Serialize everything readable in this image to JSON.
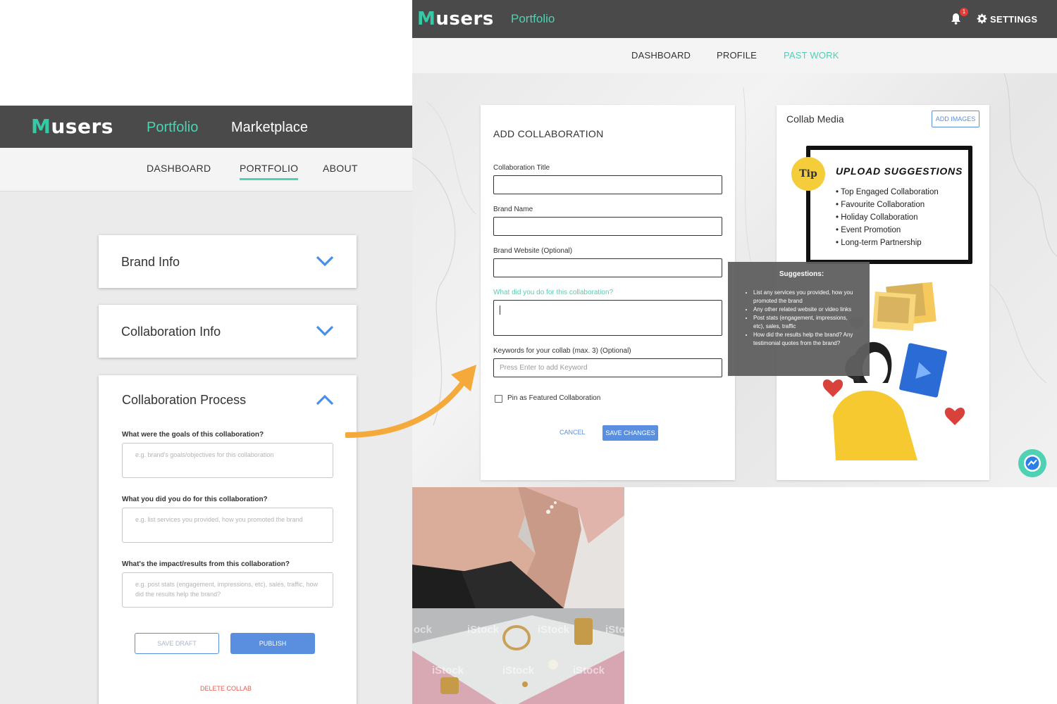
{
  "left_ui": {
    "logo": {
      "mark": "M",
      "rest": "users"
    },
    "nav": {
      "portfolio": "Portfolio",
      "marketplace": "Marketplace"
    },
    "subnav": [
      "DASHBOARD",
      "PORTFOLIO",
      "ABOUT"
    ],
    "accordions": {
      "brand_info": "Brand Info",
      "collab_info": "Collaboration Info",
      "collab_process": "Collaboration Process"
    },
    "questions": [
      {
        "label": "What were the goals of this collaboration?",
        "placeholder": "e.g. brand's goals/objectives for this collaboration"
      },
      {
        "label": "What you did you do for this collaboration?",
        "placeholder": "e.g. list services you provided, how you promoted the brand"
      },
      {
        "label": "What's the impact/results from this collaboration?",
        "placeholder": "e.g. post stats (engagement, impressions, etc), sales, traffic, how did the results help the brand?"
      }
    ],
    "buttons": {
      "save_draft": "SAVE DRAFT",
      "publish": "PUBLISH",
      "delete": "DELETE COLLAB"
    }
  },
  "right_ui": {
    "logo": {
      "mark": "M",
      "rest": "users"
    },
    "nav": {
      "portfolio": "Portfolio",
      "notification_count": "1",
      "settings": "SETTINGS"
    },
    "subnav": [
      "DASHBOARD",
      "PROFILE",
      "PAST WORK"
    ],
    "form": {
      "title": "ADD COLLABORATION",
      "fields": {
        "title": "Collaboration Title",
        "brand_name": "Brand Name",
        "brand_website": "Brand Website (Optional)",
        "what_did_you_do": "What did you do for this collaboration?",
        "keywords": "Keywords for your collab (max. 3) (Optional)",
        "keywords_placeholder": "Press Enter to add Keyword"
      },
      "pin_label": "Pin as Featured Collaboration",
      "cancel": "CANCEL",
      "save": "SAVE CHANGES"
    },
    "media": {
      "title": "Collab Media",
      "add_images": "ADD IMAGES",
      "tip_badge": "Tip",
      "tip_heading": "UPLOAD SUGGESTIONS",
      "tip_items": [
        "Top Engaged Collaboration",
        "Favourite Collaboration",
        "Holiday Collaboration",
        "Event Promotion",
        "Long-term Partnership"
      ]
    },
    "tooltip": {
      "title": "Suggestions:",
      "items": [
        "List any services you provided, how you promoted the brand",
        "Any other related website or video links",
        "Post stats (engagement, impressions, etc), sales, traffic",
        "How did the results help the brand? Any testimonial quotes from the brand?"
      ]
    }
  },
  "photos": {
    "watermark": "iStock",
    "watermark_partial": "ock"
  },
  "colors": {
    "accent_teal": "#4fd1b3",
    "primary_blue": "#5a8fe0",
    "topbar": "#4a4a4a",
    "danger": "#e05a4f",
    "tip_yellow": "#f5cc3a",
    "arrow_orange": "#f5a93a"
  }
}
